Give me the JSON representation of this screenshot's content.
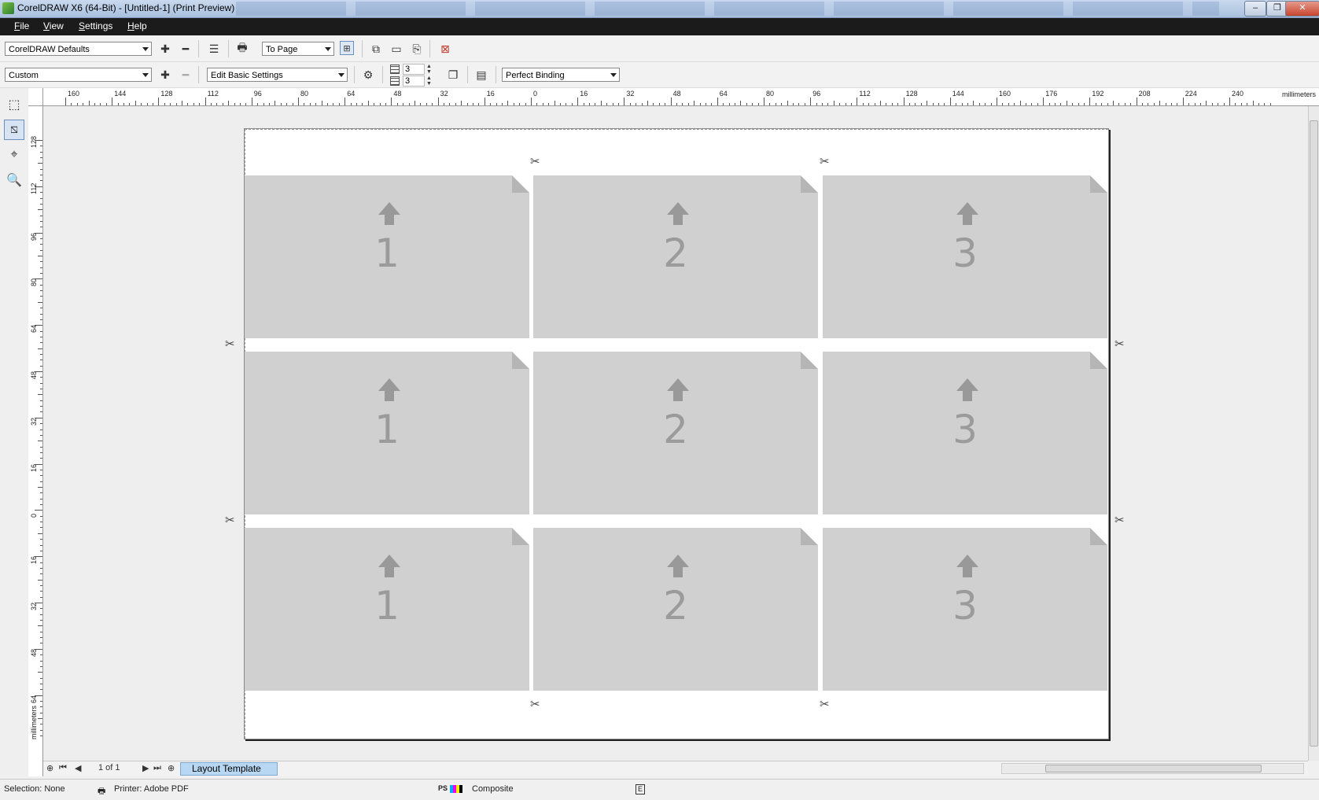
{
  "window": {
    "title": "CorelDRAW X6 (64-Bit) - [Untitled-1] (Print Preview)",
    "minimize": "–",
    "restore": "❐",
    "close": "✕"
  },
  "menu": [
    "File",
    "View",
    "Settings",
    "Help"
  ],
  "toolbar1": {
    "preset": "CorelDRAW Defaults",
    "fit": "To Page"
  },
  "toolbar2": {
    "layout_preset": "Custom",
    "settings_mode": "Edit Basic Settings",
    "columns": "3",
    "rows": "3",
    "binding": "Perfect Binding"
  },
  "ruler": {
    "h_labels": [
      "160",
      "144",
      "128",
      "112",
      "96",
      "80",
      "64",
      "48",
      "32",
      "16",
      "0",
      "16",
      "32",
      "48",
      "64",
      "80",
      "96",
      "112",
      "128",
      "144",
      "160",
      "176",
      "192",
      "208",
      "224",
      "240"
    ],
    "v_labels": [
      "128",
      "112",
      "96",
      "80",
      "64",
      "48",
      "32",
      "16",
      "0",
      "16",
      "32",
      "48",
      "64"
    ],
    "unit": "millimeters"
  },
  "cells": [
    {
      "label": "1"
    },
    {
      "label": "2"
    },
    {
      "label": "3"
    },
    {
      "label": "1"
    },
    {
      "label": "2"
    },
    {
      "label": "3"
    },
    {
      "label": "1"
    },
    {
      "label": "2"
    },
    {
      "label": "3"
    }
  ],
  "pagenav": {
    "counter": "1 of 1",
    "tab": "Layout Template"
  },
  "status": {
    "selection": "Selection: None",
    "printer": "Printer: Adobe PDF",
    "ps_badge": "PS",
    "mode": "Composite"
  }
}
